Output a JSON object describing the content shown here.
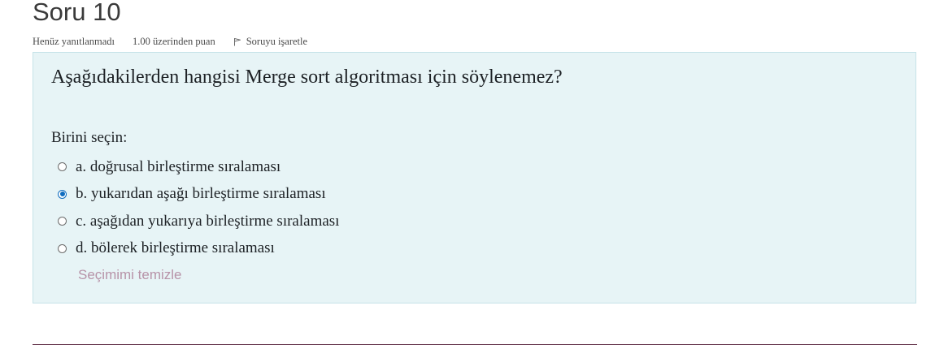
{
  "question": {
    "title": "Soru 10",
    "status": "Henüz yanıtlanmadı",
    "marks": "1.00 üzerinden puan",
    "flag_label": "Soruyu işaretle"
  },
  "content": {
    "prompt": "Aşağıdakilerden hangisi Merge sort algoritması için söylenemez?",
    "choose_label": "Birini seçin:",
    "answers": [
      {
        "label": "a. doğrusal birleştirme sıralaması",
        "selected": false
      },
      {
        "label": "b. yukarıdan aşağı birleştirme sıralaması",
        "selected": true
      },
      {
        "label": "c. aşağıdan yukarıya birleştirme sıralaması",
        "selected": false
      },
      {
        "label": "d. bölerek birleştirme sıralaması",
        "selected": false
      }
    ],
    "clear_label": "Seçimimi temizle"
  },
  "icons": {
    "flag": "flag-icon"
  },
  "colors": {
    "content_background": "#e7f4f6",
    "selected_radio": "#0f6cbf",
    "clear_link": "#b793a8",
    "bottom_rule": "#6b3d54"
  }
}
